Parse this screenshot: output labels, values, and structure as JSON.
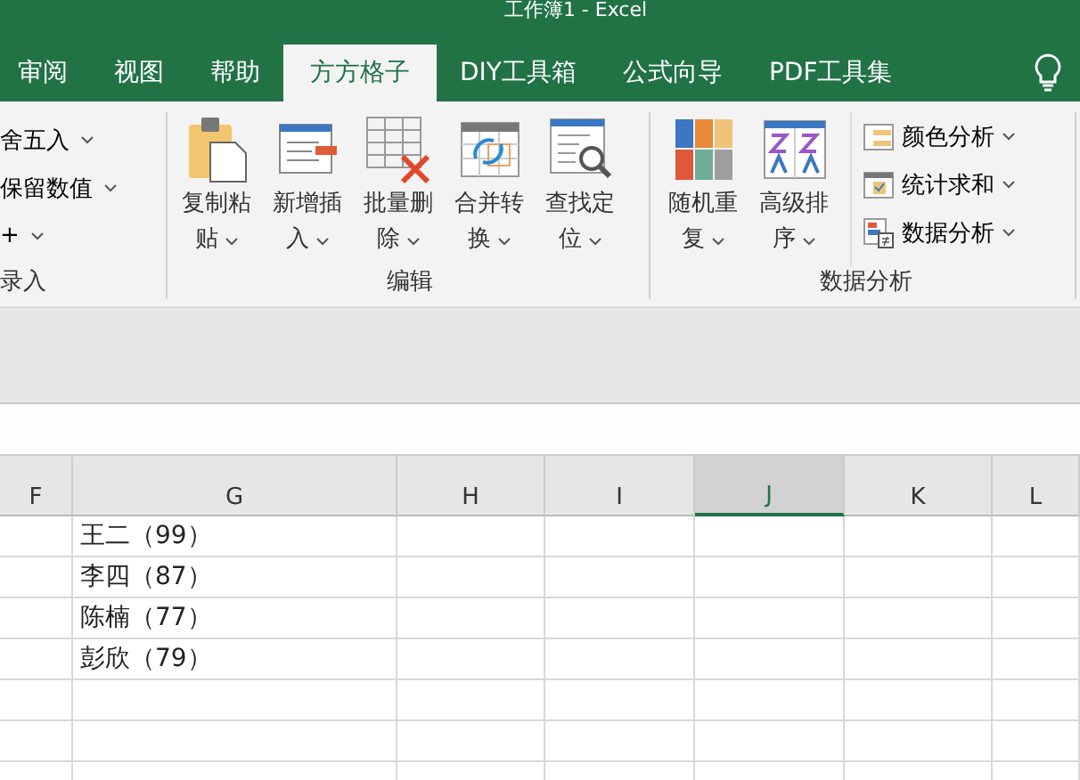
{
  "window": {
    "title": "工作簿1 - Excel"
  },
  "tabs": [
    {
      "label": "审阅",
      "selected": false
    },
    {
      "label": "视图",
      "selected": false
    },
    {
      "label": "帮助",
      "selected": false
    },
    {
      "label": "方方格子",
      "selected": true
    },
    {
      "label": "DIY工具箱",
      "selected": false
    },
    {
      "label": "公式向导",
      "selected": false
    },
    {
      "label": "PDF工具集",
      "selected": false
    }
  ],
  "ribbon": {
    "groups": [
      {
        "label": "录入",
        "items": [
          {
            "kind": "small",
            "label": "舍五入"
          },
          {
            "kind": "small",
            "label": "保留数值"
          },
          {
            "kind": "small",
            "label": "+"
          }
        ]
      },
      {
        "label": "编辑",
        "items": [
          {
            "kind": "large",
            "lines": [
              "复制粘",
              "贴"
            ]
          },
          {
            "kind": "large",
            "lines": [
              "新增插",
              "入"
            ]
          },
          {
            "kind": "large",
            "lines": [
              "批量删",
              "除"
            ]
          },
          {
            "kind": "large",
            "lines": [
              "合并转",
              "换"
            ]
          },
          {
            "kind": "large",
            "lines": [
              "查找定",
              "位"
            ]
          }
        ]
      },
      {
        "label": "数据分析",
        "items": [
          {
            "kind": "large",
            "lines": [
              "随机重",
              "复"
            ]
          },
          {
            "kind": "large",
            "lines": [
              "高级排",
              "序"
            ]
          },
          {
            "kind": "stack",
            "items": [
              {
                "label": "颜色分析"
              },
              {
                "label": "统计求和"
              },
              {
                "label": "数据分析"
              }
            ]
          }
        ]
      }
    ]
  },
  "sheet": {
    "columns": [
      {
        "label": "F",
        "selected": false
      },
      {
        "label": "G",
        "selected": false
      },
      {
        "label": "H",
        "selected": false
      },
      {
        "label": "I",
        "selected": false
      },
      {
        "label": "J",
        "selected": true
      },
      {
        "label": "K",
        "selected": false
      },
      {
        "label": "L",
        "selected": false
      }
    ],
    "rows": [
      [
        "",
        "王二（99）"
      ],
      [
        "",
        "李四（87）"
      ],
      [
        "",
        "陈楠（77）"
      ],
      [
        "",
        "彭欣（79）"
      ],
      [
        ""
      ],
      [
        ""
      ],
      [
        ""
      ]
    ]
  }
}
